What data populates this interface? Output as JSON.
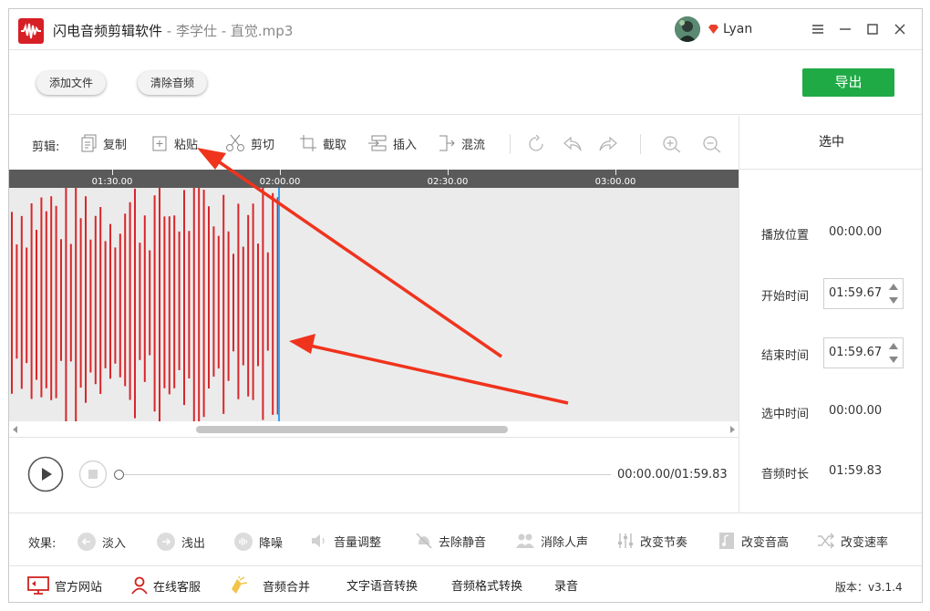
{
  "window": {
    "app_name": "闪电音频剪辑软件",
    "file_sep": " - 李学仕 - 直觉.mp3",
    "user": "Lyan"
  },
  "toolbar": {
    "add_file": "添加文件",
    "clear_audio": "清除音频",
    "export": "导出"
  },
  "edit": {
    "label": "剪辑:",
    "tools": [
      "复制",
      "粘贴",
      "剪切",
      "截取",
      "插入",
      "混流"
    ]
  },
  "timeline": {
    "ticks": [
      "01:30.00",
      "02:00.00",
      "02:30.00",
      "03:00.00"
    ]
  },
  "panel": {
    "title": "选中",
    "play_position_label": "播放位置",
    "play_position": "00:00.00",
    "start_label": "开始时间",
    "start": "01:59.67",
    "end_label": "结束时间",
    "end": "01:59.67",
    "selected_label": "选中时间",
    "selected": "00:00.00",
    "duration_label": "音频时长",
    "duration": "01:59.83"
  },
  "player": {
    "time": "00:00.00/01:59.83"
  },
  "effects": {
    "label": "效果:",
    "items": [
      "淡入",
      "浅出",
      "降噪",
      "音量调整",
      "去除静音",
      "消除人声",
      "改变节奏",
      "改变音高",
      "改变速率"
    ]
  },
  "footer": {
    "items": [
      "官方网站",
      "在线客服",
      "音频合并",
      "文字语音转换",
      "音频格式转换",
      "录音"
    ],
    "version": "版本：v3.1.4"
  },
  "colors": {
    "accent": "#1faa45",
    "wave": "#d9262b",
    "cursor": "#3aa0f0",
    "arrow": "#f0331d"
  }
}
